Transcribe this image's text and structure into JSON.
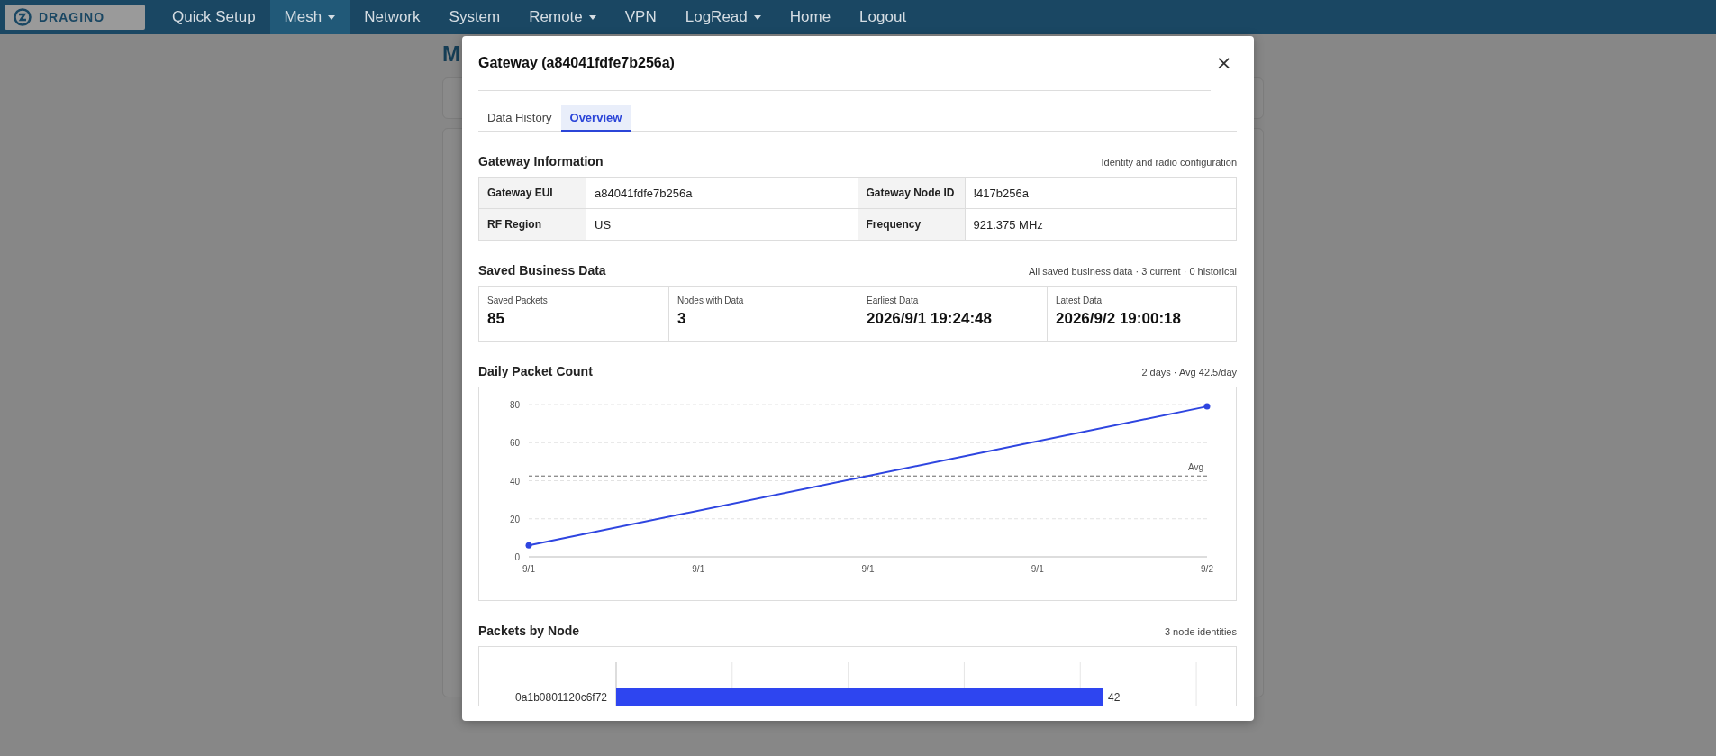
{
  "navbar": {
    "logo": "DRAGINO",
    "items": [
      {
        "label": "Quick Setup",
        "caret": false,
        "selected": false
      },
      {
        "label": "Mesh",
        "caret": true,
        "selected": true
      },
      {
        "label": "Network",
        "caret": false,
        "selected": false
      },
      {
        "label": "System",
        "caret": false,
        "selected": false
      },
      {
        "label": "Remote",
        "caret": true,
        "selected": false
      },
      {
        "label": "VPN",
        "caret": false,
        "selected": false
      },
      {
        "label": "LogRead",
        "caret": true,
        "selected": false
      },
      {
        "label": "Home",
        "caret": false,
        "selected": false
      },
      {
        "label": "Logout",
        "caret": false,
        "selected": false
      }
    ]
  },
  "background": {
    "heading": "M"
  },
  "modal": {
    "title": "Gateway (a84041fdfe7b256a)",
    "close": "×",
    "tabs": [
      {
        "label": "Data History",
        "selected": false
      },
      {
        "label": "Overview",
        "selected": true
      }
    ],
    "gateway_information": {
      "title": "Gateway Information",
      "note": "Identity and radio configuration",
      "rows": [
        {
          "label_1": "Gateway EUI",
          "value_1": "a84041fdfe7b256a",
          "label_2": "Gateway Node ID",
          "value_2": "!417b256a"
        },
        {
          "label_1": "RF Region",
          "value_1": "US",
          "label_2": "Frequency",
          "value_2": "921.375 MHz"
        }
      ]
    },
    "saved_business_data": {
      "title": "Saved Business Data",
      "note": "All saved business data · 3 current · 0 historical",
      "stats": [
        {
          "label": "Saved Packets",
          "value": "85"
        },
        {
          "label": "Nodes with Data",
          "value": "3"
        },
        {
          "label": "Earliest Data",
          "value": "2026/9/1 19:24:48"
        },
        {
          "label": "Latest Data",
          "value": "2026/9/2 19:00:18"
        }
      ]
    },
    "daily_packet_count": {
      "title": "Daily Packet Count",
      "note": "2 days · Avg 42.5/day",
      "chart_data": {
        "type": "line",
        "categories": [
          "9/1",
          "9/1",
          "9/1",
          "9/1",
          "9/2"
        ],
        "series": [
          {
            "color": "#2e45e0",
            "marker": true,
            "values": [
              6,
              null,
              null,
              null,
              79
            ]
          }
        ],
        "ylim": [
          0,
          80
        ],
        "grid": true,
        "yticks": [
          0,
          20,
          40,
          60,
          80
        ],
        "ref_lines": [
          {
            "axis": "y",
            "value": 42.5,
            "label": "Avg"
          }
        ]
      }
    },
    "packets_by_node": {
      "title": "Packets by Node",
      "note": "3 node identities",
      "chart_data": {
        "type": "bar",
        "orientation": "horizontal",
        "categories": [
          "0a1b0801120c6f72"
        ],
        "series": [
          {
            "color": "#2e45f0",
            "values": [
              42
            ]
          }
        ],
        "grid": true,
        "data_labels": true
      }
    }
  }
}
